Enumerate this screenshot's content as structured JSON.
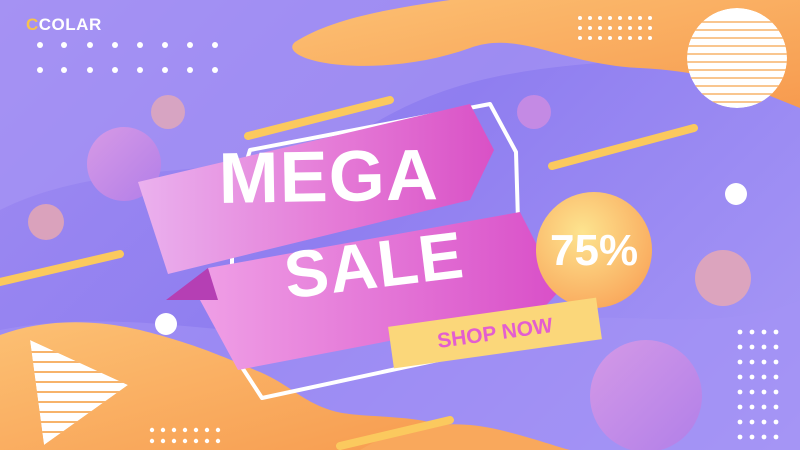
{
  "logo": {
    "text": "CCOLAR",
    "accent": "C",
    "rest": "COLAR"
  },
  "headline": {
    "line1": "MEGA",
    "line2": "SALE"
  },
  "discount": {
    "value": "75%"
  },
  "cta": {
    "label": "SHOP NOW"
  },
  "colors": {
    "background": "#9d8bf0",
    "accent_orange": "#f9a85c",
    "ribbon_pink": "#e66ad2",
    "badge_yellow": "#fbd77a",
    "cta_text": "#e35ed0",
    "headline_text": "#ffffff"
  }
}
